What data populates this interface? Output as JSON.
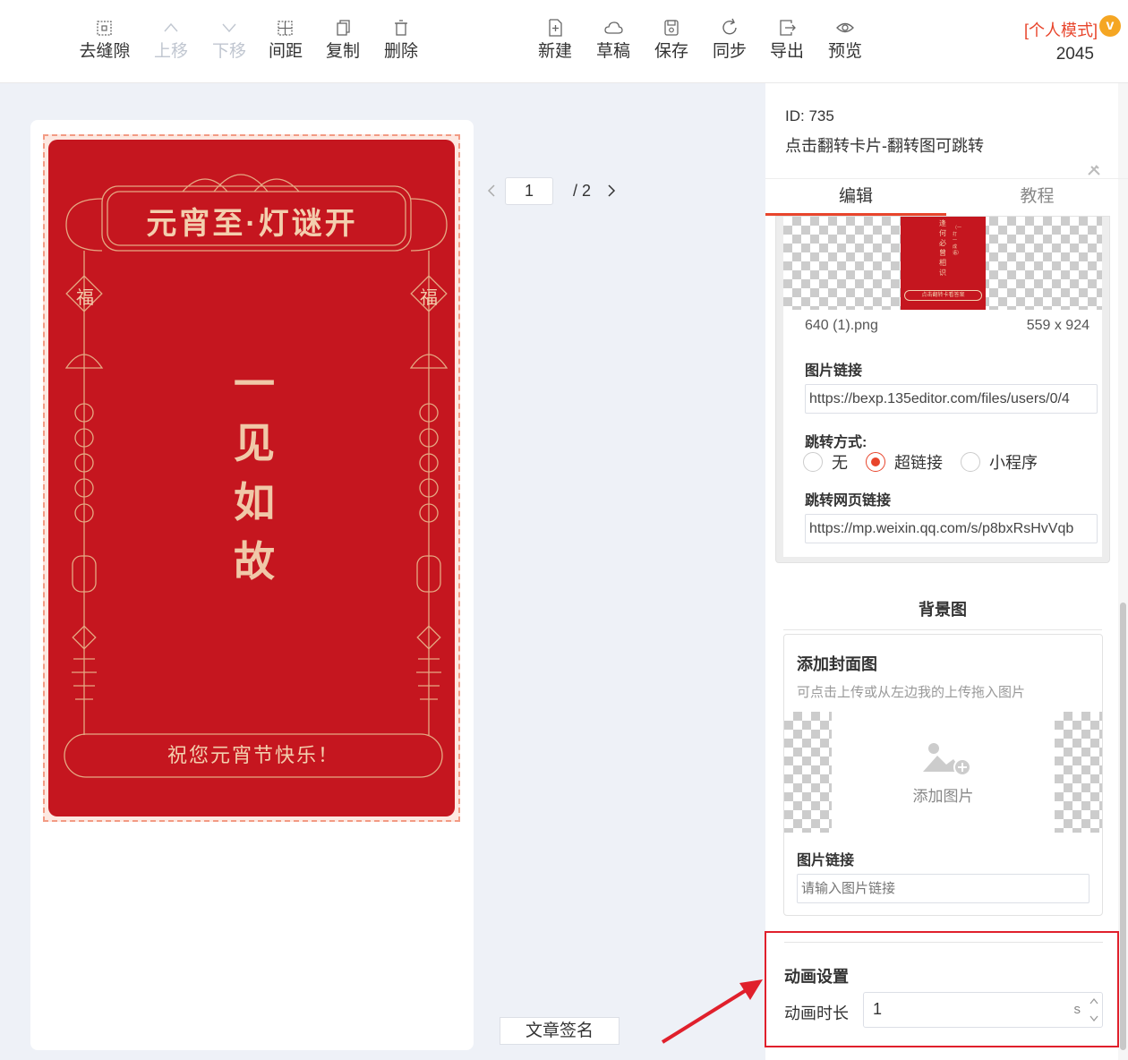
{
  "toolbar": {
    "left": [
      {
        "label": "去缝隙",
        "icon": "gap-icon",
        "disabled": false
      },
      {
        "label": "上移",
        "icon": "chevron-up-icon",
        "disabled": true
      },
      {
        "label": "下移",
        "icon": "chevron-down-icon",
        "disabled": true
      },
      {
        "label": "间距",
        "icon": "spacing-icon",
        "disabled": false
      },
      {
        "label": "复制",
        "icon": "copy-icon",
        "disabled": false
      },
      {
        "label": "删除",
        "icon": "trash-icon",
        "disabled": false
      }
    ],
    "right": [
      {
        "label": "新建",
        "icon": "new-file-icon"
      },
      {
        "label": "草稿",
        "icon": "cloud-icon"
      },
      {
        "label": "保存",
        "icon": "save-icon"
      },
      {
        "label": "同步",
        "icon": "sync-icon"
      },
      {
        "label": "导出",
        "icon": "export-icon"
      },
      {
        "label": "预览",
        "icon": "eye-icon"
      }
    ],
    "mode": "[个人模式]",
    "badge": "v",
    "count": "2045"
  },
  "poster": {
    "title": "元宵至·灯谜开",
    "vertical": "一见如故",
    "char_left": "福",
    "char_right": "福",
    "footer": "祝您元宵节快乐！"
  },
  "pager": {
    "current": "1",
    "total": "/ 2"
  },
  "sign_button": "文章签名",
  "panel": {
    "id": "ID: 735",
    "name": "点击翻转卡片-翻转图可跳转",
    "tabs": [
      "编辑",
      "教程"
    ],
    "image": {
      "mini_text": "逢何必曾相识",
      "mini_sub": "（一打一成语）",
      "mini_bar": "点击翻转卡看答案",
      "filename": "640 (1).png",
      "size": "559 x 924",
      "link_label": "图片链接",
      "link_value": "https://bexp.135editor.com/files/users/0/4",
      "jump_label": "跳转方式:",
      "jump_options": [
        "无",
        "超链接",
        "小程序"
      ],
      "jump_selected": 1,
      "web_label": "跳转网页链接",
      "web_value": "https://mp.weixin.qq.com/s/p8bxRsHvVqb"
    },
    "background": {
      "title": "背景图",
      "cover_title": "添加封面图",
      "cover_hint": "可点击上传或从左边我的上传拖入图片",
      "add_label": "添加图片",
      "link_label": "图片链接",
      "link_placeholder": "请输入图片链接"
    },
    "animation": {
      "title": "动画设置",
      "duration_label": "动画时长",
      "duration_value": "1",
      "unit": "s"
    }
  },
  "colors": {
    "accent": "#e8452c",
    "poster_red": "#c5161f",
    "gold": "#f3cfae",
    "highlight": "#e0202c"
  }
}
